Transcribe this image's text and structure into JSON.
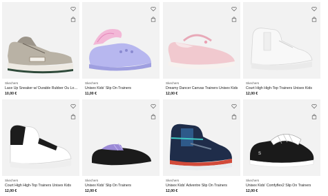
{
  "products": [
    {
      "brand": "Skechers",
      "name": "Lace Up Sneaker w/ Durable Rubber Ou Low-To...",
      "price": "10,00 €",
      "icon": "sneaker-grey"
    },
    {
      "brand": "Skechers",
      "name": "Unisex Kids' Slip On Trainers",
      "price": "11,00 €",
      "icon": "clog-lavender"
    },
    {
      "brand": "Skechers",
      "name": "Dreamy Dancer Canvas Trainers Unisex Kids",
      "price": "12,00 €",
      "icon": "mary-jane-pink"
    },
    {
      "brand": "Skechers",
      "name": "Court High High-Top Trainers Unisex Kids",
      "price": "12,00 €",
      "icon": "hightop-white"
    },
    {
      "brand": "Skechers",
      "name": "Court High High-Top Trainers Unisex Kids",
      "price": "12,00 €",
      "icon": "hightop-black-white"
    },
    {
      "brand": "Skechers",
      "name": "Unisex Kids' Slip On Trainers",
      "price": "12,00 €",
      "icon": "slipon-black-purple"
    },
    {
      "brand": "Skechers",
      "name": "Unisex Kids' Adventre Slip On Trainers",
      "price": "12,00 €",
      "icon": "adventure-navy"
    },
    {
      "brand": "Skechers",
      "name": "Unisex Kids' Comfyflex2 Slip On Trainers",
      "price": "12,00 €",
      "icon": "comfyflex-black"
    }
  ]
}
